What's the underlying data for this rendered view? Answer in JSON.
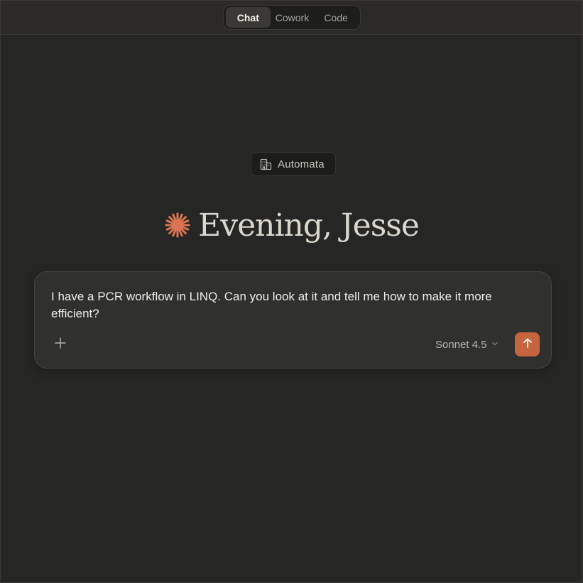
{
  "mode_switch": {
    "tabs": [
      {
        "label": "Chat",
        "active": true
      },
      {
        "label": "Cowork",
        "active": false
      },
      {
        "label": "Code",
        "active": false
      }
    ]
  },
  "organization": {
    "icon": "building-icon",
    "name": "Automata"
  },
  "greeting": {
    "icon": "sparkle-icon",
    "text": "Evening, Jesse"
  },
  "composer": {
    "input_value": "I have a PCR workflow in LINQ. Can you look at it and tell me how to make it more efficient?",
    "add_icon": "plus-icon",
    "model_label": "Sonnet 4.5",
    "model_icon": "chevron-down-icon",
    "send_icon": "arrow-up-icon"
  },
  "colors": {
    "background": "#262624",
    "accent": "#c4653f",
    "composer_bg": "#30302e"
  }
}
